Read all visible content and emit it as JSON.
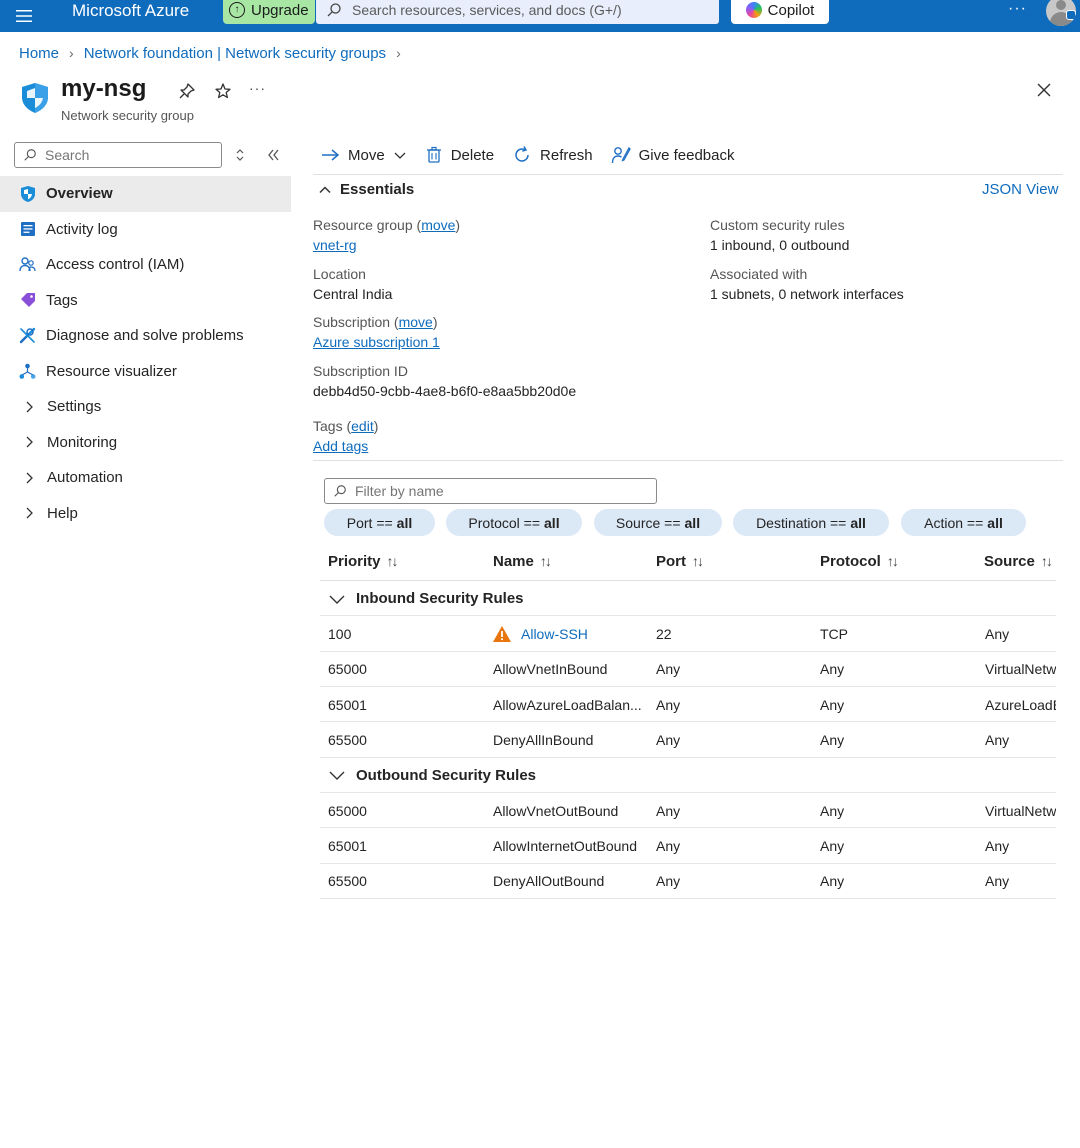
{
  "topbar": {
    "brand": "Microsoft Azure",
    "upgrade_label": "Upgrade",
    "search_placeholder": "Search resources, services, and docs (G+/)",
    "copilot_label": "Copilot",
    "more": "···"
  },
  "breadcrumb": {
    "items": [
      "Home",
      "Network foundation | Network security groups"
    ]
  },
  "resource": {
    "name": "my-nsg",
    "type": "Network security group",
    "more": "···"
  },
  "sidebar": {
    "search_placeholder": "Search",
    "items": [
      {
        "label": "Overview",
        "icon": "shield-icon"
      },
      {
        "label": "Activity log",
        "icon": "activity-log-icon"
      },
      {
        "label": "Access control (IAM)",
        "icon": "people-icon"
      },
      {
        "label": "Tags",
        "icon": "tag-icon"
      },
      {
        "label": "Diagnose and solve problems",
        "icon": "wrench-icon"
      },
      {
        "label": "Resource visualizer",
        "icon": "visualizer-icon"
      },
      {
        "label": "Settings",
        "icon": "chevron-right-icon"
      },
      {
        "label": "Monitoring",
        "icon": "chevron-right-icon"
      },
      {
        "label": "Automation",
        "icon": "chevron-right-icon"
      },
      {
        "label": "Help",
        "icon": "chevron-right-icon"
      }
    ]
  },
  "commands": {
    "move": "Move",
    "delete": "Delete",
    "refresh": "Refresh",
    "feedback": "Give feedback"
  },
  "essentials": {
    "title": "Essentials",
    "json_view": "JSON View",
    "resource_group_label": "Resource group",
    "resource_group_move": "move",
    "resource_group_value": "vnet-rg",
    "location_label": "Location",
    "location_value": "Central India",
    "subscription_label": "Subscription",
    "subscription_move": "move",
    "subscription_value": "Azure subscription 1",
    "subscription_id_label": "Subscription ID",
    "subscription_id_value": "debb4d50-9cbb-4ae8-b6f0-e8aa5bb20d0e",
    "tags_label": "Tags",
    "tags_edit": "edit",
    "tags_add": "Add tags",
    "custom_rules_label": "Custom security rules",
    "custom_rules_value": "1 inbound, 0 outbound",
    "associated_label": "Associated with",
    "associated_value": "1 subnets, 0 network interfaces"
  },
  "filter": {
    "placeholder": "Filter by name",
    "pills": [
      {
        "label": "Port == ",
        "value": "all"
      },
      {
        "label": "Protocol == ",
        "value": "all"
      },
      {
        "label": "Source == ",
        "value": "all"
      },
      {
        "label": "Destination == ",
        "value": "all"
      },
      {
        "label": "Action == ",
        "value": "all"
      }
    ]
  },
  "table": {
    "columns": [
      "Priority",
      "Name",
      "Port",
      "Protocol",
      "Source"
    ],
    "inbound_label": "Inbound Security Rules",
    "outbound_label": "Outbound Security Rules",
    "inbound": [
      {
        "priority": "100",
        "name": "Allow-SSH",
        "port": "22",
        "protocol": "TCP",
        "source": "Any",
        "warning": true
      },
      {
        "priority": "65000",
        "name": "AllowVnetInBound",
        "port": "Any",
        "protocol": "Any",
        "source": "VirtualNetw"
      },
      {
        "priority": "65001",
        "name": "AllowAzureLoadBalan...",
        "port": "Any",
        "protocol": "Any",
        "source": "AzureLoadB"
      },
      {
        "priority": "65500",
        "name": "DenyAllInBound",
        "port": "Any",
        "protocol": "Any",
        "source": "Any"
      }
    ],
    "outbound": [
      {
        "priority": "65000",
        "name": "AllowVnetOutBound",
        "port": "Any",
        "protocol": "Any",
        "source": "VirtualNetw"
      },
      {
        "priority": "65001",
        "name": "AllowInternetOutBound",
        "port": "Any",
        "protocol": "Any",
        "source": "Any"
      },
      {
        "priority": "65500",
        "name": "DenyAllOutBound",
        "port": "Any",
        "protocol": "Any",
        "source": "Any"
      }
    ]
  },
  "colors": {
    "topbar": "#0f6cbd",
    "link": "#0f6cbd",
    "upgrade": "#a8e6a4",
    "pill": "#dbe8f6",
    "warning": "#e8760d"
  }
}
